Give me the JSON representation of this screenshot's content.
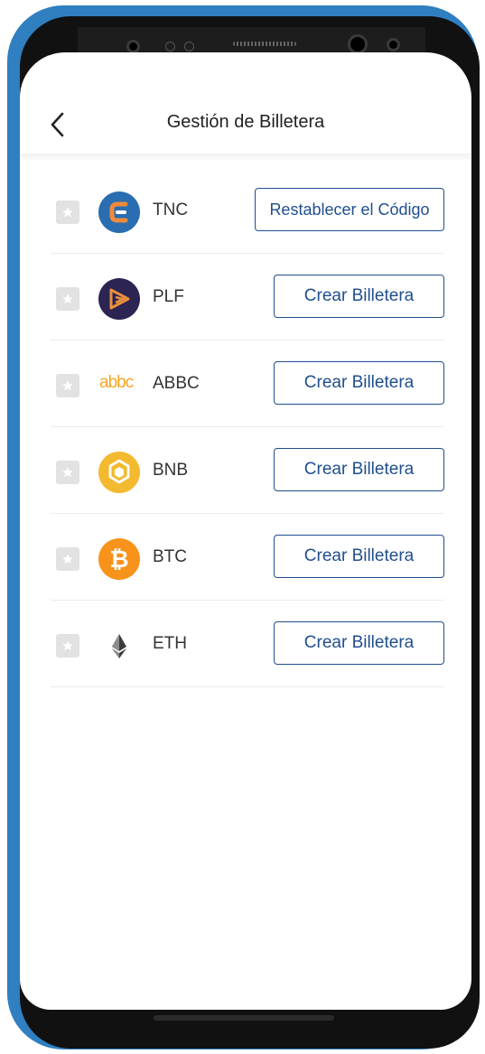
{
  "header": {
    "title": "Gestión de Billetera"
  },
  "coins": [
    {
      "symbol": "TNC",
      "button": "Restablecer el Código"
    },
    {
      "symbol": "PLF",
      "button": "Crear Billetera"
    },
    {
      "symbol": "ABBC",
      "button": "Crear Billetera",
      "logo_text": "abbc"
    },
    {
      "symbol": "BNB",
      "button": "Crear Billetera"
    },
    {
      "symbol": "BTC",
      "button": "Crear Billetera"
    },
    {
      "symbol": "ETH",
      "button": "Crear Billetera"
    }
  ],
  "icons": [
    "back-arrow-icon",
    "star-icon",
    "tnc-logo-icon",
    "plf-logo-icon",
    "abbc-logo-icon",
    "bnb-logo-icon",
    "btc-logo-icon",
    "eth-logo-icon"
  ],
  "colors": {
    "frame": "#2f7fc1",
    "button_accent": "#1f4e8e",
    "bnb": "#f3ba2f",
    "btc": "#f7931a",
    "abbc": "#f5a623",
    "plf": "#2c2452",
    "tnc": "#2a6db0"
  }
}
